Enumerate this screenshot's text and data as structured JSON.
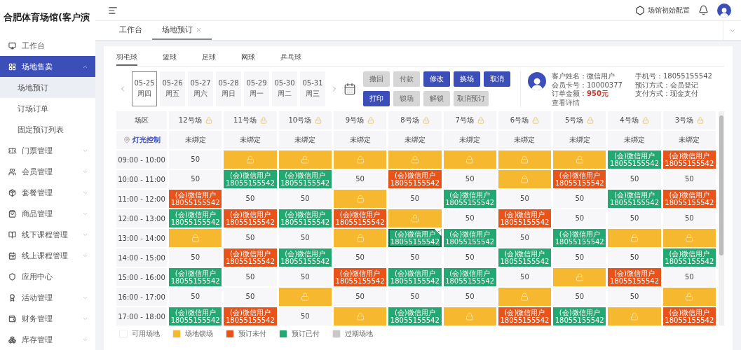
{
  "sidebar": {
    "title": "合肥体育场馆(客户演",
    "items": [
      {
        "label": "工作台",
        "selected": false,
        "expandable": false
      },
      {
        "label": "场地售卖",
        "selected": true,
        "expandable": true,
        "expanded": true,
        "children": [
          {
            "label": "场地预订",
            "selected": true
          },
          {
            "label": "订场订单",
            "selected": false
          },
          {
            "label": "固定预订列表",
            "selected": false
          }
        ]
      },
      {
        "label": "门票管理",
        "selected": false,
        "expandable": true,
        "expanded": false
      },
      {
        "label": "会员管理",
        "selected": false,
        "expandable": true,
        "expanded": false
      },
      {
        "label": "套餐管理",
        "selected": false,
        "expandable": true,
        "expanded": false
      },
      {
        "label": "商品管理",
        "selected": false,
        "expandable": true,
        "expanded": false
      },
      {
        "label": "线下课程管理",
        "selected": false,
        "expandable": true,
        "expanded": false
      },
      {
        "label": "线上课程管理",
        "selected": false,
        "expandable": true,
        "expanded": false
      },
      {
        "label": "应用中心",
        "selected": false,
        "expandable": false
      },
      {
        "label": "活动管理",
        "selected": false,
        "expandable": true,
        "expanded": false
      },
      {
        "label": "财务管理",
        "selected": false,
        "expandable": true,
        "expanded": false
      },
      {
        "label": "库存管理",
        "selected": false,
        "expandable": true,
        "expanded": false
      }
    ]
  },
  "header": {
    "config_label": "场馆初始配置"
  },
  "page_tabs": [
    {
      "label": "工作台",
      "selected": false,
      "closable": false
    },
    {
      "label": "场地预订",
      "selected": true,
      "closable": true
    }
  ],
  "sport_tabs": [
    {
      "label": "羽毛球",
      "selected": true
    },
    {
      "label": "篮球",
      "selected": false
    },
    {
      "label": "足球",
      "selected": false
    },
    {
      "label": "网球",
      "selected": false
    },
    {
      "label": "乒乓球",
      "selected": false
    }
  ],
  "dates": [
    {
      "date": "05-25",
      "weekday": "周四",
      "selected": true
    },
    {
      "date": "05-26",
      "weekday": "周五",
      "selected": false
    },
    {
      "date": "05-27",
      "weekday": "周六",
      "selected": false
    },
    {
      "date": "05-28",
      "weekday": "周日",
      "selected": false
    },
    {
      "date": "05-29",
      "weekday": "周一",
      "selected": false
    },
    {
      "date": "05-30",
      "weekday": "周二",
      "selected": false
    },
    {
      "date": "05-31",
      "weekday": "周三",
      "selected": false
    }
  ],
  "action_rows": [
    [
      {
        "label": "撤回",
        "disabled": true
      },
      {
        "label": "付款",
        "disabled": true
      },
      {
        "label": "修改",
        "disabled": false
      },
      {
        "label": "换场",
        "disabled": false
      },
      {
        "label": "取消",
        "disabled": false
      }
    ],
    [
      {
        "label": "打印",
        "disabled": false
      },
      {
        "label": "锁场",
        "disabled": true
      },
      {
        "label": "解锁",
        "disabled": true
      },
      {
        "label": "取消预订",
        "disabled": true
      }
    ]
  ],
  "customer": {
    "left": [
      {
        "label": "客户姓名：",
        "value": "微信用户"
      },
      {
        "label": "会员卡号：",
        "value": "10000377"
      }
    ],
    "amount": {
      "label": "订单金额：",
      "value": "950元"
    },
    "link": "查看详情",
    "right": [
      {
        "label": "手机号：",
        "value": "18055155542"
      },
      {
        "label": "预订方式：",
        "value": "会员登记"
      },
      {
        "label": "支付方式：",
        "value": "现金支付"
      }
    ]
  },
  "grid": {
    "corner": "场区",
    "light_label": "灯光控制",
    "courts": [
      {
        "name": "12号场",
        "binding": "未绑定"
      },
      {
        "name": "11号场",
        "binding": "未绑定"
      },
      {
        "name": "10号场",
        "binding": "未绑定"
      },
      {
        "name": "9号场",
        "binding": "未绑定"
      },
      {
        "name": "8号场",
        "binding": "未绑定"
      },
      {
        "name": "7号场",
        "binding": "未绑定"
      },
      {
        "name": "6号场",
        "binding": "未绑定"
      },
      {
        "name": "5号场",
        "binding": "未绑定"
      },
      {
        "name": "4号场",
        "binding": "未绑定"
      },
      {
        "name": "3号场",
        "binding": "未绑定"
      }
    ],
    "rows": [
      {
        "time": "09:00 - 10:00",
        "cells": [
          {
            "kind": "free",
            "price": "50",
            "selected": false
          },
          {
            "kind": "locked",
            "selected": false
          },
          {
            "kind": "locked",
            "selected": false
          },
          {
            "kind": "locked",
            "selected": false
          },
          {
            "kind": "locked",
            "selected": false
          },
          {
            "kind": "locked",
            "selected": false
          },
          {
            "kind": "locked",
            "selected": false
          },
          {
            "kind": "locked",
            "selected": false
          },
          {
            "kind": "paid",
            "name": "(会)微信用户",
            "phone": "18055155542",
            "selected": false
          },
          {
            "kind": "unpaid",
            "name": "(会)微信用户",
            "phone": "18055155542",
            "selected": false
          }
        ]
      },
      {
        "time": "10:00 - 11:00",
        "cells": [
          {
            "kind": "free",
            "price": "50",
            "selected": false
          },
          {
            "kind": "paid",
            "name": "(会)微信用户",
            "phone": "18055155542",
            "selected": false
          },
          {
            "kind": "paid",
            "name": "(会)微信用户",
            "phone": "18055155542",
            "selected": false
          },
          {
            "kind": "free",
            "price": "50",
            "selected": false
          },
          {
            "kind": "unpaid",
            "name": "(会)微信用户",
            "phone": "18055155542",
            "selected": false
          },
          {
            "kind": "free",
            "price": "50",
            "selected": false
          },
          {
            "kind": "locked",
            "selected": false
          },
          {
            "kind": "unpaid",
            "name": "(会)微信用户",
            "phone": "18055155542",
            "selected": false
          },
          {
            "kind": "free",
            "price": "50",
            "selected": false
          },
          {
            "kind": "free",
            "price": "50",
            "selected": false
          }
        ]
      },
      {
        "time": "11:00 - 12:00",
        "cells": [
          {
            "kind": "unpaid",
            "name": "(会)微信用户",
            "phone": "18055155542",
            "selected": false
          },
          {
            "kind": "free",
            "price": "50",
            "selected": false
          },
          {
            "kind": "free",
            "price": "50",
            "selected": false
          },
          {
            "kind": "locked",
            "selected": false
          },
          {
            "kind": "free",
            "price": "50",
            "selected": false
          },
          {
            "kind": "paid",
            "name": "(会)微信用户",
            "phone": "18055155542",
            "selected": false
          },
          {
            "kind": "free",
            "price": "50",
            "selected": false
          },
          {
            "kind": "free",
            "price": "50",
            "selected": false
          },
          {
            "kind": "paid",
            "name": "(会)微信用户",
            "phone": "18055155542",
            "selected": false
          },
          {
            "kind": "unpaid",
            "name": "(会)微信用户",
            "phone": "18055155542",
            "selected": false
          }
        ]
      },
      {
        "time": "12:00 - 13:00",
        "cells": [
          {
            "kind": "paid",
            "name": "(会)微信用户",
            "phone": "18055155542",
            "selected": false
          },
          {
            "kind": "unpaid",
            "name": "(会)微信用户",
            "phone": "18055155542",
            "selected": false
          },
          {
            "kind": "paid",
            "name": "(会)微信用户",
            "phone": "18055155542",
            "selected": false
          },
          {
            "kind": "unpaid",
            "name": "(会)微信用户",
            "phone": "18055155542",
            "selected": false
          },
          {
            "kind": "locked",
            "selected": false
          },
          {
            "kind": "free",
            "price": "50",
            "selected": false
          },
          {
            "kind": "unpaid",
            "name": "(会)微信用户",
            "phone": "18055155542",
            "selected": false
          },
          {
            "kind": "free",
            "price": "50",
            "selected": false
          },
          {
            "kind": "free",
            "price": "50",
            "selected": false
          },
          {
            "kind": "free",
            "price": "50",
            "selected": false
          }
        ]
      },
      {
        "time": "13:00 - 14:00",
        "cells": [
          {
            "kind": "locked",
            "selected": false
          },
          {
            "kind": "free",
            "price": "50",
            "selected": false
          },
          {
            "kind": "free",
            "price": "50",
            "selected": false
          },
          {
            "kind": "locked",
            "selected": false
          },
          {
            "kind": "paid",
            "name": "(会)微信用户",
            "phone": "18055155542",
            "selected": true
          },
          {
            "kind": "paid",
            "name": "(会)微信用户",
            "phone": "18055155542",
            "selected": false
          },
          {
            "kind": "free",
            "price": "50",
            "selected": false
          },
          {
            "kind": "paid",
            "name": "(会)微信用户",
            "phone": "18055155542",
            "selected": false
          },
          {
            "kind": "locked",
            "selected": false
          },
          {
            "kind": "locked",
            "selected": false
          }
        ]
      },
      {
        "time": "14:00 - 15:00",
        "cells": [
          {
            "kind": "free",
            "price": "50",
            "selected": false
          },
          {
            "kind": "unpaid",
            "name": "(会)微信用户",
            "phone": "18055155542",
            "selected": false
          },
          {
            "kind": "paid",
            "name": "(会)微信用户",
            "phone": "18055155542",
            "selected": false
          },
          {
            "kind": "free",
            "price": "50",
            "selected": false
          },
          {
            "kind": "free",
            "price": "50",
            "selected": false
          },
          {
            "kind": "free",
            "price": "50",
            "selected": false
          },
          {
            "kind": "paid",
            "name": "(会)微信用户",
            "phone": "18055155542",
            "selected": false
          },
          {
            "kind": "free",
            "price": "50",
            "selected": false
          },
          {
            "kind": "free",
            "price": "50",
            "selected": false
          },
          {
            "kind": "paid",
            "name": "(会)微信用户",
            "phone": "18055155542",
            "selected": false
          }
        ]
      },
      {
        "time": "15:00 - 16:00",
        "cells": [
          {
            "kind": "paid",
            "name": "(会)微信用户",
            "phone": "18055155542",
            "selected": false
          },
          {
            "kind": "free",
            "price": "50",
            "selected": false
          },
          {
            "kind": "free",
            "price": "50",
            "selected": false
          },
          {
            "kind": "unpaid",
            "name": "(会)微信用户",
            "phone": "18055155542",
            "selected": false
          },
          {
            "kind": "paid",
            "name": "(会)微信用户",
            "phone": "18055155542",
            "selected": false
          },
          {
            "kind": "paid",
            "name": "(会)微信用户",
            "phone": "18055155542",
            "selected": false
          },
          {
            "kind": "free",
            "price": "50",
            "selected": false
          },
          {
            "kind": "locked",
            "selected": false
          },
          {
            "kind": "unpaid",
            "name": "(会)微信用户",
            "phone": "18055155542",
            "selected": false
          },
          {
            "kind": "free",
            "price": "50",
            "selected": false
          }
        ]
      },
      {
        "time": "16:00 - 17:00",
        "cells": [
          {
            "kind": "free",
            "price": "50",
            "selected": false
          },
          {
            "kind": "free",
            "price": "50",
            "selected": false
          },
          {
            "kind": "locked",
            "selected": false
          },
          {
            "kind": "free",
            "price": "50",
            "selected": false
          },
          {
            "kind": "free",
            "price": "50",
            "selected": false
          },
          {
            "kind": "free",
            "price": "50",
            "selected": false
          },
          {
            "kind": "locked",
            "selected": false
          },
          {
            "kind": "free",
            "price": "50",
            "selected": false
          },
          {
            "kind": "free",
            "price": "50",
            "selected": false
          },
          {
            "kind": "locked",
            "selected": false
          }
        ]
      },
      {
        "time": "17:00 - 18:00",
        "cells": [
          {
            "kind": "paid",
            "name": "(会)微信用户",
            "phone": "18055155542",
            "selected": false
          },
          {
            "kind": "unpaid",
            "name": "(会)微信用户",
            "phone": "18055155542",
            "selected": false
          },
          {
            "kind": "free",
            "price": "50",
            "selected": false
          },
          {
            "kind": "locked",
            "selected": false
          },
          {
            "kind": "paid",
            "name": "(会)微信用户",
            "phone": "18055155542",
            "selected": false
          },
          {
            "kind": "locked",
            "selected": false
          },
          {
            "kind": "unpaid",
            "name": "(会)微信用户",
            "phone": "18055155542",
            "selected": false
          },
          {
            "kind": "paid",
            "name": "(会)微信用户",
            "phone": "18055155542",
            "selected": false
          },
          {
            "kind": "locked",
            "selected": false
          },
          {
            "kind": "unpaid",
            "name": "(会)微信用户",
            "phone": "18055155542",
            "selected": false
          }
        ]
      }
    ]
  },
  "legend": [
    {
      "label": "可用场地",
      "color": "#ffffff"
    },
    {
      "label": "场地锁场",
      "color": "#f5b82e"
    },
    {
      "label": "预订未付",
      "color": "#e8531a"
    },
    {
      "label": "预订已付",
      "color": "#22a870"
    },
    {
      "label": "过期场地",
      "color": "#c8c8c8"
    }
  ]
}
